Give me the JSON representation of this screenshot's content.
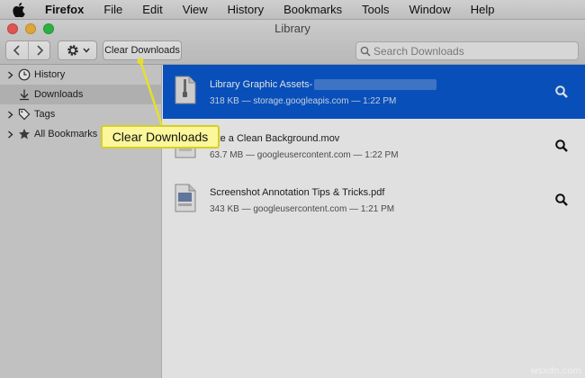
{
  "menubar": {
    "items": [
      "Firefox",
      "File",
      "Edit",
      "View",
      "History",
      "Bookmarks",
      "Tools",
      "Window",
      "Help"
    ]
  },
  "window": {
    "title": "Library"
  },
  "toolbar": {
    "clear_label": "Clear Downloads",
    "search_placeholder": "Search Downloads"
  },
  "sidebar": {
    "items": [
      {
        "label": "History",
        "icon": "clock-icon",
        "expandable": true
      },
      {
        "label": "Downloads",
        "icon": "download-arrow-icon",
        "expandable": false
      },
      {
        "label": "Tags",
        "icon": "tag-icon",
        "expandable": true
      },
      {
        "label": "All Bookmarks",
        "icon": "star-icon",
        "expandable": true
      }
    ]
  },
  "downloads": [
    {
      "name": "Library Graphic Assets-",
      "meta": "318 KB — storage.googleapis.com — 1:22 PM",
      "selected": true
    },
    {
      "name": "ake a Clean Background.mov",
      "meta": "63.7 MB — googleusercontent.com — 1:22 PM",
      "selected": false
    },
    {
      "name": "Screenshot Annotation Tips & Tricks.pdf",
      "meta": "343 KB — googleusercontent.com — 1:21 PM",
      "selected": false
    }
  ],
  "callout": {
    "text": "Clear Downloads"
  },
  "watermark": "wsxdn.com",
  "colors": {
    "selection": "#0a5bd4",
    "callout_bg": "#fbf79a",
    "callout_border": "#d5cf2a"
  }
}
